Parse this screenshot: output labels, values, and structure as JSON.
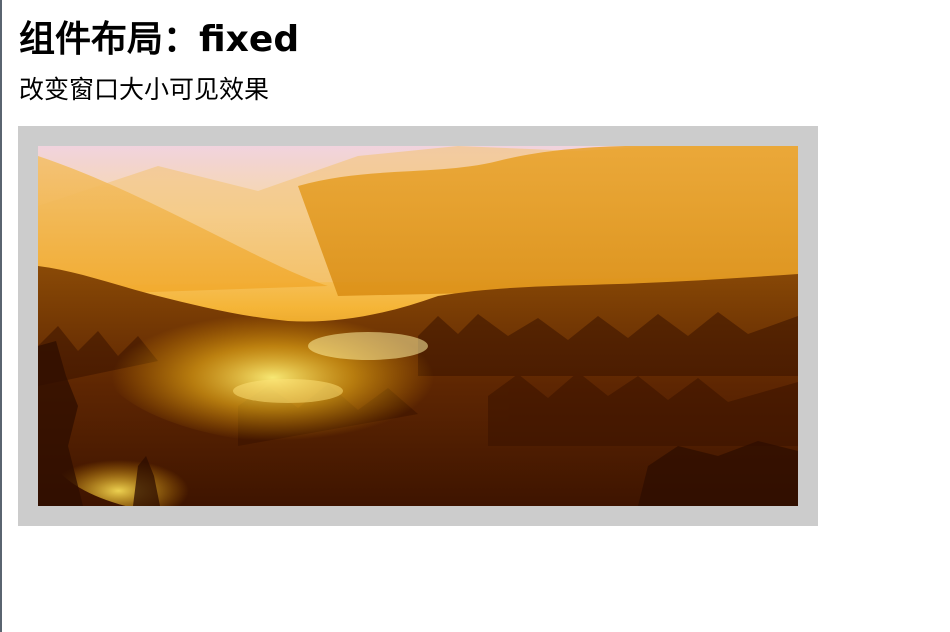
{
  "header": {
    "title": "组件布局：fixed",
    "subtitle": "改变窗口大小可见效果"
  },
  "colors": {
    "frame_border": "#cccccc",
    "sky_top": "#f1d3de",
    "haze": "#f6b53a",
    "forest_dark": "#4a1800"
  },
  "image": {
    "name": "misty-golden-forest-landscape"
  }
}
